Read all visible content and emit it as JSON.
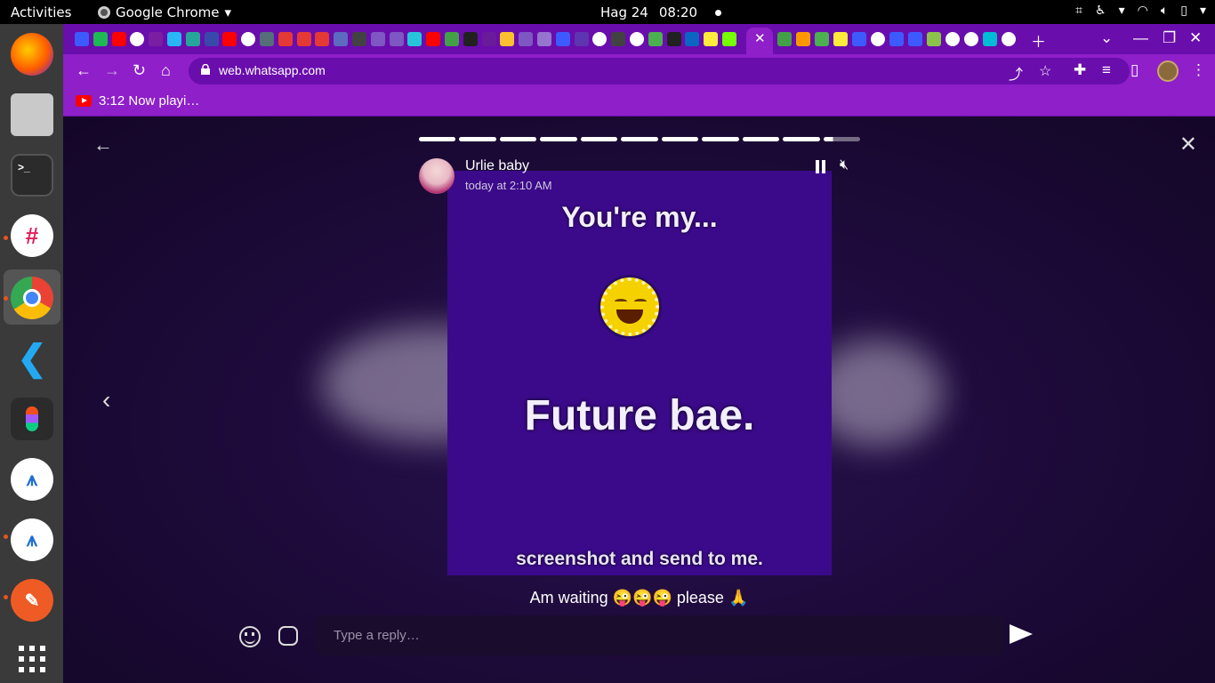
{
  "topbar": {
    "activities": "Activities",
    "app_name": "Google Chrome",
    "date": "Hag 24",
    "time": "08:20"
  },
  "browser": {
    "url": "web.whatsapp.com",
    "bookmark": "3:12 Now playi…",
    "accent": "#8e1fc9"
  },
  "status": {
    "poster_name": "Urlie baby",
    "posted_time": "today at 2:10 AM",
    "text_line1": "You're my...",
    "text_line2": "Future bae.",
    "text_line3": "screenshot and send to me.",
    "caption": "Am waiting 😜😜😜 please 🙏",
    "segments_total": 11,
    "segments_viewed": 10,
    "current_segment_progress": 0.25,
    "reply_placeholder": "Type a reply…"
  },
  "dock": {
    "apps": [
      "firefox-icon",
      "files-icon",
      "terminal-icon",
      "slack-icon",
      "chrome-icon",
      "vscode-icon",
      "figma-icon",
      "android-studio-icon",
      "android-studio-icon-2",
      "postman-icon",
      "show-apps-icon"
    ]
  }
}
